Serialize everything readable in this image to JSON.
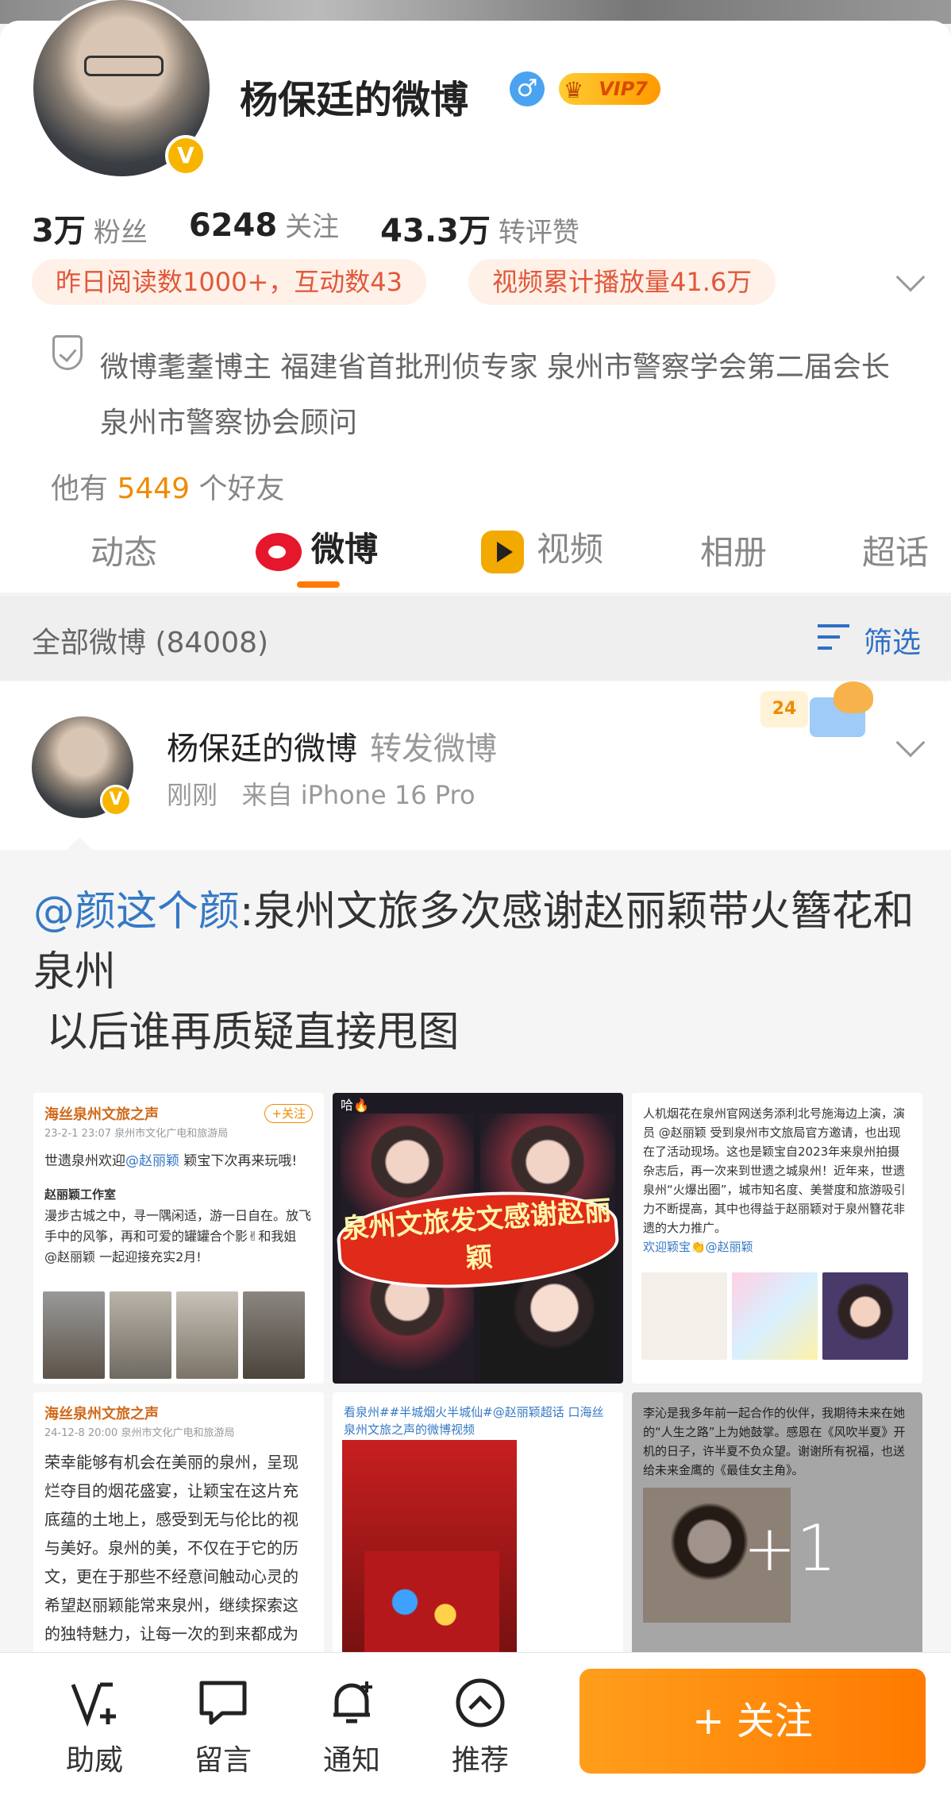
{
  "profile": {
    "name": "杨保廷的微博",
    "gender_symbol": "♂",
    "vip_label": "VIP7",
    "verified_mark": "V",
    "stats": [
      {
        "num": "3万",
        "label": "粉丝"
      },
      {
        "num": "6248",
        "label": "关注"
      },
      {
        "num": "43.3万",
        "label": "转评赞"
      }
    ],
    "pill_reads": "昨日阅读数1000+，互动数43",
    "pill_video": "视频累计播放量41.6万",
    "bio": "微博耄耋博主 福建省首批刑侦专家 泉州市警察学会第二届会长 泉州市警察协会顾问",
    "friends_prefix": "他有",
    "friends_count": "5449",
    "friends_suffix": "个好友"
  },
  "tabs": [
    "动态",
    "微博",
    "视频",
    "相册",
    "超话"
  ],
  "filter": {
    "all_label": "全部微博 (84008)",
    "filter_label": "筛选"
  },
  "post": {
    "author": "杨保廷的微博",
    "action": "转发微博",
    "time": "刚刚",
    "source": "来自 iPhone 16 Pro",
    "mascot_badge": "24",
    "repost_mention": "@颜这个颜",
    "repost_body": ":泉州文旅多次感谢赵丽颖带火簪花和泉州\n 以后谁再质疑直接甩图",
    "thumbs": {
      "t1_account": "海丝泉州文旅之声",
      "t1_date": "23-2-1 23:07  泉州市文化广电和旅游局",
      "t1_follow": "+关注",
      "t1_line1": "世遗泉州欢迎",
      "t1_mention": "@赵丽颖",
      "t1_line1b": " 颖宝下次再来玩哦!",
      "t1_studio": "赵丽颖工作室",
      "t1_text": "漫步古城之中，寻一隅闲适，游一日自在。放飞手中的风筝，再和可爱的罐罐合个影✌和我姐 @赵丽颖 一起迎接充实2月!",
      "t2_top": "哈🔥",
      "t2_banner": "泉州文旅发文感谢赵丽颖",
      "t3_text": "人机烟花在泉州官网送务添利北号施海边上演，演员 @赵丽颖 受到泉州市文旅局官方邀请，也出现在了活动现场。这也是颖宝自2023年来泉州拍摄杂志后，再一次来到世遗之城泉州！近年来，世遗泉州“火爆出圈”，城市知名度、美誉度和旅游吸引力不断提高，其中也得益于赵丽颖对于泉州簪花非遗的大力推广。",
      "t3_welcome": "欢迎颖宝👏@赵丽颖",
      "t4_account": "海丝泉州文旅之声",
      "t4_date": "24-12-8 20:00  泉州市文化广电和旅游局",
      "t4_text": "荣幸能够有机会在美丽的泉州，呈现烂夺目的烟花盛宴，让颖宝在这片充底蕴的土地上，感受到无与伦比的视与美好。泉州的美，不仅在于它的历文，更在于那些不经意间触动心灵的希望赵丽颖能常来泉州，继续探索这的独特魅力，让每一次的到来都成为忘的记忆。",
      "t5_text": "看泉州##半城烟火半城仙#@赵丽颖超话 口海丝泉州文旅之声的微博视频",
      "t6_text": "李沁是我多年前一起合作的伙伴，我期待未来在她的“人生之路”上为她鼓掌。感恩在《风吹半夏》开机的日子，许半夏不负众望。谢谢所有祝福，也送给未来金鹰的《最佳女主角》。",
      "t6_more": "+1"
    }
  },
  "bottom": {
    "items": [
      "助威",
      "留言",
      "通知",
      "推荐"
    ],
    "follow": "+ 关注"
  }
}
